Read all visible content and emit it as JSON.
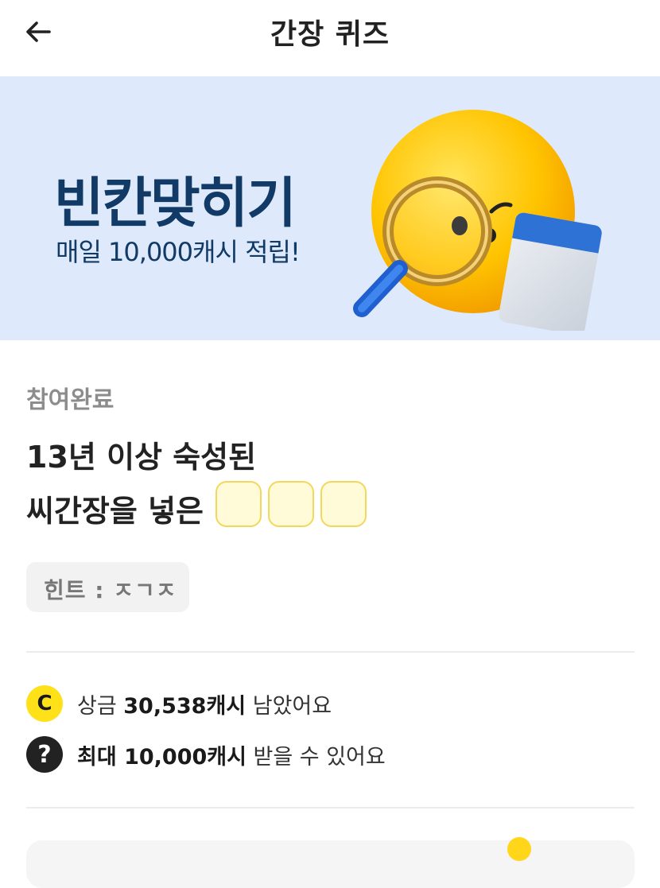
{
  "header": {
    "title": "간장 퀴즈",
    "back_icon": "arrow-left-icon"
  },
  "banner": {
    "headline": "빈칸맞히기",
    "subtitle": "매일 10,000캐시 적립!",
    "art": "emoji-magnifier-calendar"
  },
  "quiz": {
    "status": "참여완료",
    "question_line1": "13년 이상 숙성된",
    "question_line2": "씨간장을 넣은",
    "blank_count": 3,
    "hint": "힌트 : ㅈㄱㅈ"
  },
  "info": {
    "prize_icon_label": "C",
    "prize_prefix": "상금 ",
    "prize_amount": "30,538캐시",
    "prize_suffix": " 남았어요",
    "max_icon_label": "?",
    "max_amount": "최대 10,000캐시",
    "max_suffix": " 받을 수 있어요"
  },
  "colors": {
    "banner_bg": "#deeafb",
    "banner_text": "#123a66",
    "blank_fill": "#fffbd9",
    "blank_border": "#f2d85a",
    "coin_yellow": "#ffe11a"
  }
}
